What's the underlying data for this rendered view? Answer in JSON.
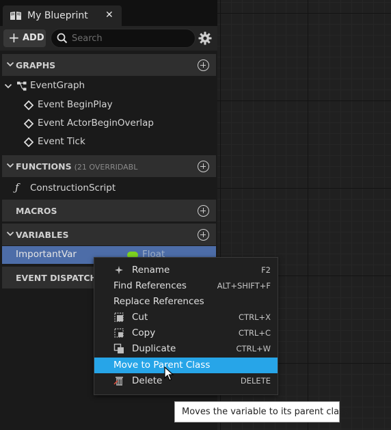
{
  "tab": {
    "title": "My Blueprint",
    "close": "✕"
  },
  "toolbar": {
    "add_label": "ADD",
    "search_placeholder": "Search"
  },
  "sections": {
    "graphs": "GRAPHS",
    "functions": "FUNCTIONS",
    "functions_sub": "(21 OVERRIDABL",
    "macros": "MACROS",
    "variables": "VARIABLES",
    "event_dispatchers": "EVENT DISPATCHE"
  },
  "graph_items": {
    "event_graph": "EventGraph",
    "events": [
      "Event BeginPlay",
      "Event ActorBeginOverlap",
      "Event Tick"
    ]
  },
  "functions_items": [
    "ConstructionScript"
  ],
  "variable": {
    "name": "ImportantVar",
    "type": "Float",
    "type_color": "#7ed321"
  },
  "context_menu": {
    "items": [
      {
        "label": "Rename",
        "shortcut": "F2",
        "icon": "rename-icon"
      },
      {
        "label": "Find References",
        "shortcut": "ALT+SHIFT+F",
        "icon": ""
      },
      {
        "label": "Replace References",
        "shortcut": "",
        "icon": ""
      },
      {
        "label": "Cut",
        "shortcut": "CTRL+X",
        "icon": "cut-icon"
      },
      {
        "label": "Copy",
        "shortcut": "CTRL+C",
        "icon": "copy-icon"
      },
      {
        "label": "Duplicate",
        "shortcut": "CTRL+W",
        "icon": "duplicate-icon"
      },
      {
        "label": "Move to Parent Class",
        "shortcut": "",
        "icon": ""
      },
      {
        "label": "Delete",
        "shortcut": "DELETE",
        "icon": "delete-icon"
      }
    ],
    "highlighted_index": 6,
    "highlight_color": "#27a5e8"
  },
  "tooltip": "Moves the variable to its parent class"
}
